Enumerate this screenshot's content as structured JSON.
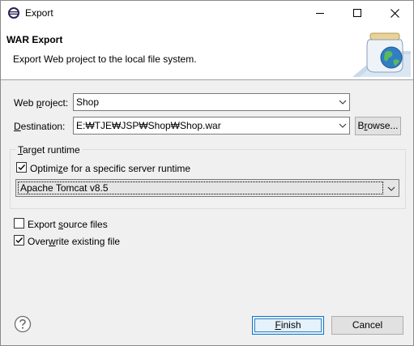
{
  "window": {
    "title": "Export",
    "icon": "eclipse-icon",
    "controls": {
      "minimize": "minimize-icon",
      "maximize": "maximize-icon",
      "close": "close-icon"
    }
  },
  "banner": {
    "title": "WAR Export",
    "description": "Export Web project to the local file system.",
    "graphic": "jar-globe-icon"
  },
  "form": {
    "web_project_label_pre": "Web ",
    "web_project_label_u": "p",
    "web_project_label_post": "roject:",
    "web_project_value": "Shop",
    "destination_label_u": "D",
    "destination_label_post": "estination:",
    "destination_value": "E:₩TJE₩JSP₩Shop₩Shop.war",
    "browse_label_pre": "B",
    "browse_label_u": "r",
    "browse_label_post": "owse..."
  },
  "target_runtime": {
    "group_title_u": "T",
    "group_title_post": "arget runtime",
    "optimize_label_pre": "Optimi",
    "optimize_label_u": "z",
    "optimize_label_post": "e for a specific server runtime",
    "optimize_checked": true,
    "runtime_value": "Apache Tomcat v8.5"
  },
  "options": {
    "export_source_pre": "Export ",
    "export_source_u": "s",
    "export_source_post": "ource files",
    "export_source_checked": false,
    "overwrite_pre": "Over",
    "overwrite_u": "w",
    "overwrite_post": "rite existing file",
    "overwrite_checked": true
  },
  "footer": {
    "help_icon": "help-icon",
    "finish_u": "F",
    "finish_post": "inish",
    "cancel_label": "Cancel"
  }
}
